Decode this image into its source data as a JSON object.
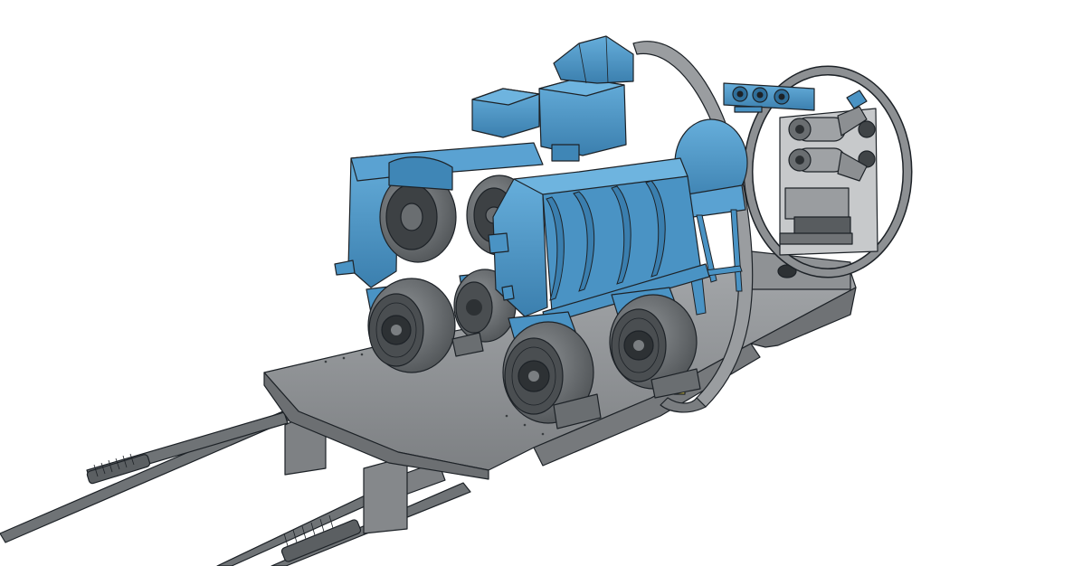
{
  "scene": {
    "colors": {
      "background": "#ffffff",
      "blue": "#4a93c4",
      "blue_dark": "#2f6f9b",
      "blue_light": "#66aedb",
      "gray": "#8a8d90",
      "gray_dark": "#5f6366",
      "gray_light": "#a9acae",
      "edge": "#1d2227"
    }
  }
}
